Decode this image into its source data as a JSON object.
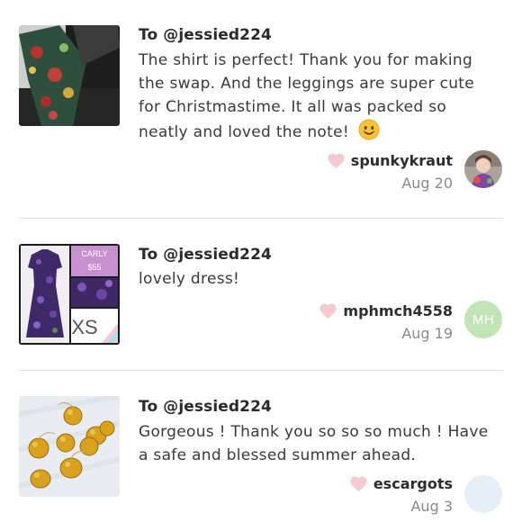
{
  "feed": {
    "items": [
      {
        "to_label": "To @jessied224",
        "message": "The shirt is perfect! Thank you for making the swap. And the leggings are super cute for Christmastime. It all was packed so neatly and loved the note!",
        "emoji": "smiling-face-icon",
        "username": "spunkykraut",
        "date": "Aug 20",
        "avatar": "photo"
      },
      {
        "to_label": "To @jessied224",
        "message": "lovely dress!",
        "username": "mphmch4558",
        "date": "Aug 19",
        "avatar": "MH",
        "thumb_labels": {
          "name": "CARLY",
          "price": "$55",
          "size": "XS"
        }
      },
      {
        "to_label": "To @jessied224",
        "message": "Gorgeous ! Thank you so so so much ! Have a safe and blessed summer ahead.",
        "username": "escargots",
        "date": "Aug 3",
        "avatar": "blank"
      }
    ]
  },
  "colors": {
    "heart": "#f6c9cf",
    "avatar_mh": "#bfe5b5",
    "avatar_blank": "#e6eef7",
    "divider": "#e3e3e3"
  }
}
